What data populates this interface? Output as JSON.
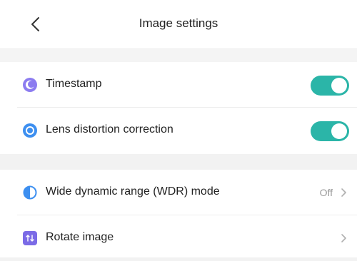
{
  "header": {
    "title": "Image settings",
    "back_icon": "chevron-left-icon"
  },
  "settings": {
    "timestamp": {
      "label": "Timestamp",
      "icon": "clock-icon",
      "icon_color": "#8c7cf0",
      "enabled": true
    },
    "lens_distortion": {
      "label": "Lens distortion correction",
      "icon": "lens-icon",
      "icon_color": "#3d8ff0",
      "enabled": true
    },
    "wdr": {
      "label": "Wide dynamic range (WDR) mode",
      "icon": "contrast-icon",
      "icon_color": "#3d8ff0",
      "value": "Off"
    },
    "rotate": {
      "label": "Rotate image",
      "icon": "rotate-icon",
      "icon_color": "#7b6be6"
    }
  },
  "colors": {
    "toggle_on": "#2bb5a8"
  }
}
